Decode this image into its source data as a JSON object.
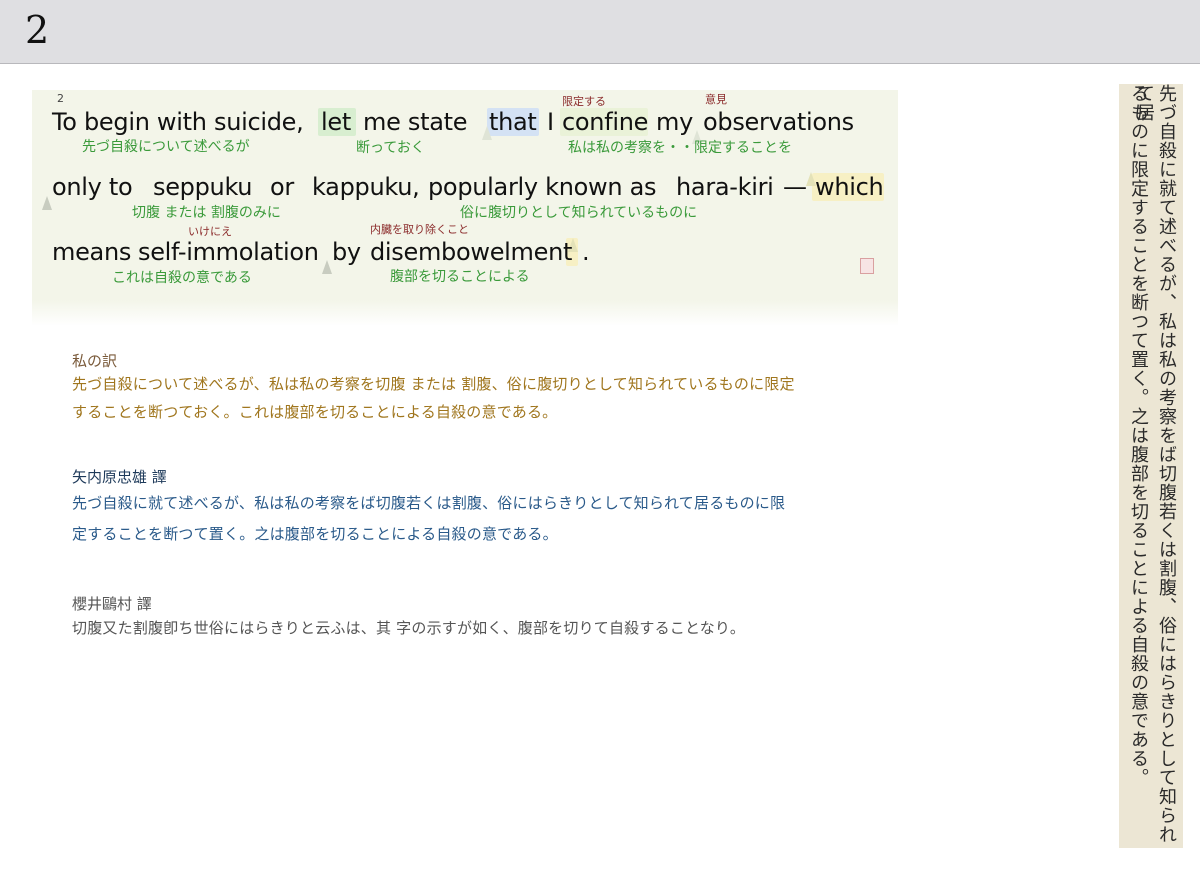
{
  "header": {
    "page_number": "2"
  },
  "annotated": {
    "footnote": "2",
    "line1": {
      "segments": [
        "To begin with suicide,",
        "let",
        "me state",
        "that",
        "I",
        "confine",
        "my",
        "observations"
      ],
      "glosses": [
        "先づ自殺について述べるが",
        "断っておく",
        "私は私の考察を・・限定することを"
      ],
      "rubies": [
        "限定する",
        "意見"
      ]
    },
    "line2": {
      "segments": [
        "only to",
        "seppuku",
        "or",
        "kappuku,",
        "popularly known as",
        "hara-kiri",
        "—",
        "which"
      ],
      "glosses": [
        "切腹 または 割腹のみに",
        "俗に腹切りとして知られているものに"
      ],
      "rubies": [
        "いけにえ",
        "内臓を取り除くこと"
      ]
    },
    "line3": {
      "segments": [
        "means",
        "self-immolation",
        "by",
        "disembowelment",
        "."
      ],
      "glosses": [
        "これは自殺の意である",
        "腹部を切ることによる"
      ]
    }
  },
  "translations": {
    "mine": {
      "title": "私の訳",
      "lines": [
        "先づ自殺について述べるが、私は私の考察を切腹 または 割腹、俗に腹切りとして知られているものに限定",
        "することを断つておく。これは腹部を切ることによる自殺の意である。"
      ]
    },
    "yanaihara": {
      "title": "矢内原忠雄 譯",
      "lines": [
        "先づ自殺に就て述べるが、私は私の考察をば切腹若くは割腹、俗にはらきりとして知られて居るものに限",
        "定することを断つて置く。之は腹部を切ることによる自殺の意である。"
      ]
    },
    "sakurai": {
      "title": "櫻井鷗村 譯",
      "lines": [
        "切腹又た割腹卽ち世俗にはらきりと云ふは、其 字の示すが如く、腹部を切りて自殺することなり。"
      ]
    }
  },
  "scan": {
    "col1": "先づ自殺に就て述べるが、私は私の考察をば切腹若くは割腹、俗にはらきりとして知られて居",
    "col2": "るものに限定することを断つて置く。之は腹部を切ることによる自殺の意である。"
  },
  "colors": {
    "gloss": "#3a9a3a",
    "ruby": "#8b2b2b",
    "mine": "#a0761e",
    "yanaihara": "#2a5a8a",
    "sakurai": "#555555"
  }
}
